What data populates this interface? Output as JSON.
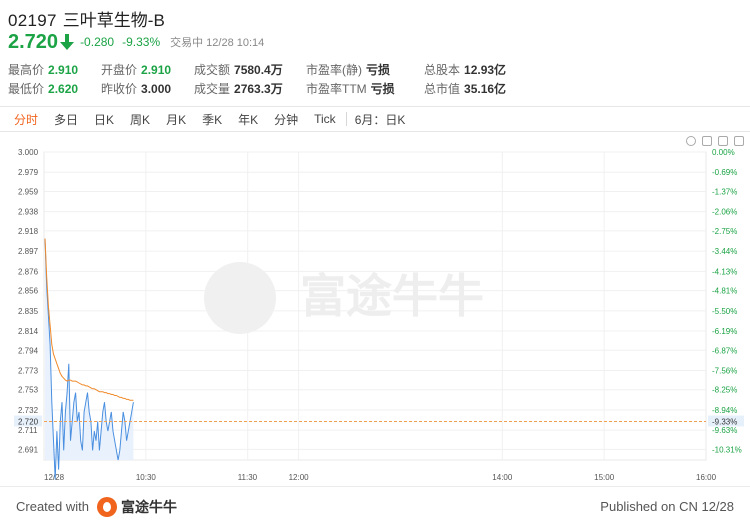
{
  "header": {
    "code": "02197",
    "name": "三叶草生物-B",
    "price": "2.720",
    "change": "-0.280",
    "change_pct": "-9.33%",
    "status": "交易中 12/28 10:14"
  },
  "stats": {
    "rows": [
      [
        {
          "label": "最高价",
          "value": "2.910",
          "style": "green"
        },
        {
          "label": "开盘价",
          "value": "2.910",
          "style": "green"
        },
        {
          "label": "成交额",
          "value": "7580.4万",
          "style": "dark"
        },
        {
          "label": "市盈率(静)",
          "value": "亏损",
          "style": "dark"
        },
        {
          "label": "总股本",
          "value": "12.93亿",
          "style": "dark"
        }
      ],
      [
        {
          "label": "最低价",
          "value": "2.620",
          "style": "green"
        },
        {
          "label": "昨收价",
          "value": "3.000",
          "style": "dark"
        },
        {
          "label": "成交量",
          "value": "2763.3万",
          "style": "dark"
        },
        {
          "label": "市盈率TTM",
          "value": "亏损",
          "style": "dark"
        },
        {
          "label": "总市值",
          "value": "35.16亿",
          "style": "dark"
        }
      ]
    ]
  },
  "tabs": [
    "分时",
    "多日",
    "日K",
    "周K",
    "月K",
    "季K",
    "年K",
    "分钟",
    "Tick",
    "6月：日K"
  ],
  "active_tab": 0,
  "watermark": "富途牛牛",
  "footer": {
    "created_with": "Created with",
    "brand": "富途牛牛",
    "published": "Published on CN 12/28"
  },
  "colors": {
    "down": "#1ba345",
    "accent": "#f0641e",
    "price_line": "#4a8fe0",
    "avg_line": "#f08a2a",
    "ref_line": "#f0a050"
  },
  "chart_data": {
    "type": "line",
    "ylabels_left": [
      "3.000",
      "2.979",
      "2.959",
      "2.938",
      "2.918",
      "2.897",
      "2.876",
      "2.856",
      "2.835",
      "2.814",
      "2.794",
      "2.773",
      "2.753",
      "2.732",
      "2.711",
      "2.691"
    ],
    "ylabels_right": [
      "0.00%",
      "-0.69%",
      "-1.37%",
      "-2.06%",
      "-2.75%",
      "-3.44%",
      "-4.13%",
      "-4.81%",
      "-5.50%",
      "-6.19%",
      "-6.87%",
      "-7.56%",
      "-8.25%",
      "-8.94%",
      "-9.63%",
      "-10.31%"
    ],
    "ylim": [
      2.68,
      3.0
    ],
    "xlabels": [
      "12/28",
      "10:30",
      "11:30",
      "12:00",
      "14:00",
      "15:00",
      "16:00"
    ],
    "current_price_label": "2.720",
    "current_pct_label": "-9.33%",
    "current_price": 2.72,
    "session_minutes": 390,
    "x_marks": [
      0,
      60,
      120,
      150,
      270,
      330,
      390
    ],
    "price": [
      2.91,
      2.86,
      2.83,
      2.8,
      2.74,
      2.7,
      2.66,
      2.71,
      2.67,
      2.72,
      2.74,
      2.69,
      2.73,
      2.75,
      2.78,
      2.7,
      2.72,
      2.74,
      2.75,
      2.72,
      2.73,
      2.7,
      2.69,
      2.73,
      2.74,
      2.75,
      2.73,
      2.72,
      2.69,
      2.71,
      2.7,
      2.72,
      2.69,
      2.71,
      2.73,
      2.74,
      2.72,
      2.71,
      2.72,
      2.73,
      2.71,
      2.7,
      2.69,
      2.68,
      2.69,
      2.71,
      2.73,
      2.72,
      2.7,
      2.71,
      2.72,
      2.73,
      2.74
    ],
    "avg": [
      2.91,
      2.87,
      2.84,
      2.82,
      2.8,
      2.79,
      2.785,
      2.78,
      2.775,
      2.77,
      2.767,
      2.765,
      2.763,
      2.762,
      2.763,
      2.763,
      2.762,
      2.762,
      2.762,
      2.761,
      2.76,
      2.759,
      2.758,
      2.758,
      2.757,
      2.757,
      2.756,
      2.755,
      2.754,
      2.754,
      2.753,
      2.752,
      2.751,
      2.751,
      2.751,
      2.75,
      2.75,
      2.749,
      2.749,
      2.748,
      2.748,
      2.747,
      2.747,
      2.746,
      2.745,
      2.745,
      2.744,
      2.744,
      2.743,
      2.743,
      2.742,
      2.742,
      2.742
    ]
  }
}
